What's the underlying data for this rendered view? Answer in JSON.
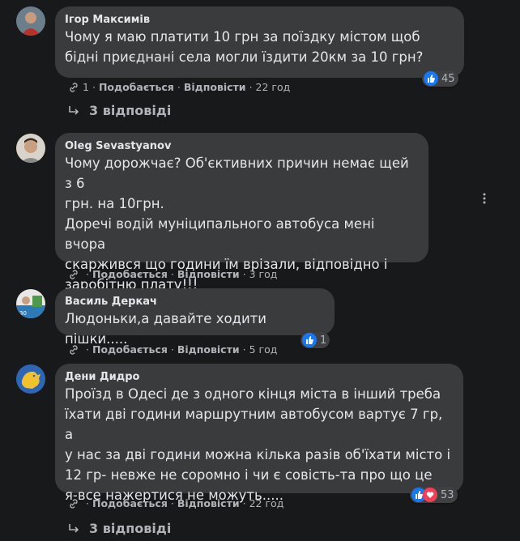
{
  "comments": [
    {
      "author": "Ігор Максимів",
      "lines": [
        "Чому я маю платити 10 грн за поїздку містом щоб",
        "бідні приєднані села могли їздити 20км за 10 грн?"
      ],
      "link_count": "1",
      "like_label": "Подобається",
      "reply_label": "Відповісти",
      "time": "22 год",
      "reactions": "45",
      "replies": "3 відповіді"
    },
    {
      "author": "Oleg Sevastyanov",
      "lines": [
        "Чому дорожчає? Об'єктивних причин немає щей з 6",
        "грн. на 10грн.",
        "Доречі водій муніципального автобуса мені вчора",
        "скаржився що години їм врізали, відповідно і",
        "заробітню плату!!!"
      ],
      "like_label": "Подобається",
      "reply_label": "Відповісти",
      "time": "3 год"
    },
    {
      "author": "Василь Деркач",
      "lines": [
        "Людоньки,а давайте ходити пішки....."
      ],
      "like_label": "Подобається",
      "reply_label": "Відповісти",
      "time": "5 год",
      "reactions": "1"
    },
    {
      "author": "Дени Дидро",
      "lines": [
        "Проїзд в Одесі де з одного кінця міста в інший треба",
        "їхати дві години маршрутним автобусом вартує 7 гр, а",
        "у нас за дві години можна кілька разів об'їхати місто і",
        "12 гр- невже не соромно і чи є совість-та про що це",
        "я-все нажертися не можуть....."
      ],
      "like_label": "Подобається",
      "reply_label": "Відповісти",
      "time": "22 год",
      "reactions": "53",
      "replies": "3 відповіді"
    }
  ],
  "icons": {
    "link": "link-icon",
    "like": "like-icon",
    "love": "love-icon",
    "reply_arrow": "reply-arrow-icon",
    "more": "more-options-icon"
  },
  "colors": {
    "background": "#18191a",
    "bubble": "#3a3b3c",
    "like": "#1877f2",
    "love": "#f33e58"
  }
}
